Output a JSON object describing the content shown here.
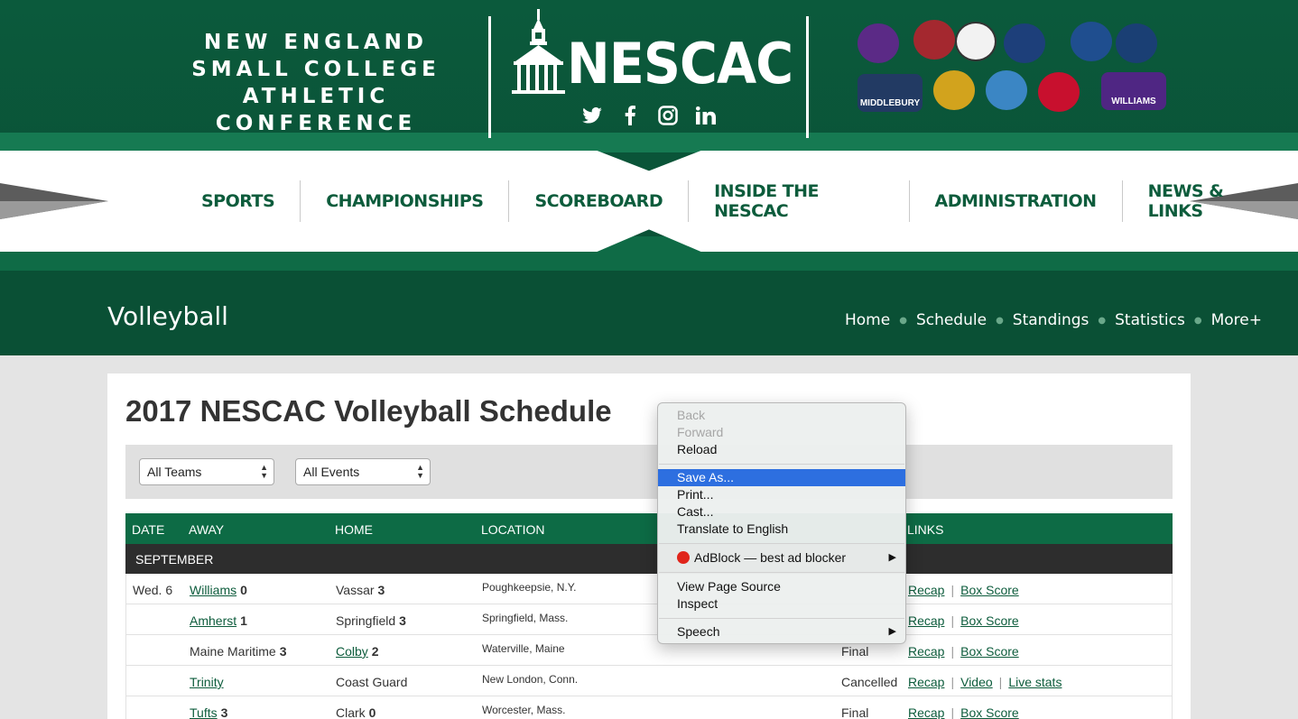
{
  "header": {
    "tagline": [
      "NEW ENGLAND",
      "SMALL COLLEGE",
      "ATHLETIC CONFERENCE"
    ],
    "logo_text": "NESCAC",
    "social": [
      "twitter-icon",
      "facebook-icon",
      "instagram-icon",
      "linkedin-icon"
    ],
    "teams": [
      {
        "icon": "amherst-mammoth-logo",
        "color": "#5b2a86"
      },
      {
        "icon": "bates-bobcat-logo",
        "color": "#a4282f"
      },
      {
        "icon": "bowdoin-polar-bear-logo",
        "color": "#f2f2f2"
      },
      {
        "icon": "colby-mule-logo",
        "color": "#1d3f7a"
      },
      {
        "icon": "conn-college-logo",
        "color": "#1f4e8f"
      },
      {
        "icon": "hamilton-logo",
        "color": "#1a3f74"
      },
      {
        "icon": "middlebury-panther-logo",
        "label": "MIDDLEBURY",
        "color": "#223a63"
      },
      {
        "icon": "trinity-bantam-logo",
        "color": "#d2a31d"
      },
      {
        "icon": "tufts-jumbo-logo",
        "color": "#3b86c4"
      },
      {
        "icon": "wesleyan-logo",
        "color": "#c8102e"
      },
      {
        "icon": "williams-ephs-logo",
        "label": "WILLIAMS",
        "color": "#4f2683"
      }
    ]
  },
  "main_nav": [
    "SPORTS",
    "CHAMPIONSHIPS",
    "SCOREBOARD",
    "INSIDE THE NESCAC",
    "ADMINISTRATION",
    "NEWS & LINKS"
  ],
  "sport": {
    "title": "Volleyball",
    "nav": [
      "Home",
      "Schedule",
      "Standings",
      "Statistics",
      "More+"
    ]
  },
  "page_title": "2017 NESCAC Volleyball Schedule",
  "filters": {
    "teams": "All Teams",
    "events": "All Events"
  },
  "table": {
    "headers": [
      "DATE",
      "AWAY",
      "HOME",
      "LOCATION",
      "LINKS"
    ],
    "month": "SEPTEMBER",
    "rows": [
      {
        "date": "Wed. 6",
        "away": "Williams",
        "away_link": true,
        "away_score": "0",
        "home": "Vassar",
        "home_link": false,
        "home_score": "3",
        "location": "Poughkeepsie, N.Y.",
        "result": "",
        "links": [
          "Recap",
          "Box Score"
        ]
      },
      {
        "date": "",
        "away": "Amherst",
        "away_link": true,
        "away_score": "1",
        "home": "Springfield",
        "home_link": false,
        "home_score": "3",
        "location": "Springfield, Mass.",
        "result": "",
        "links": [
          "Recap",
          "Box Score"
        ]
      },
      {
        "date": "",
        "away": "Maine Maritime",
        "away_link": false,
        "away_score": "3",
        "home": "Colby",
        "home_link": true,
        "home_score": "2",
        "location": "Waterville, Maine",
        "result": "Final",
        "links": [
          "Recap",
          "Box Score"
        ]
      },
      {
        "date": "",
        "away": "Trinity",
        "away_link": true,
        "away_score": "",
        "home": "Coast Guard",
        "home_link": false,
        "home_score": "",
        "location": "New London, Conn.",
        "result": "Cancelled",
        "links": [
          "Recap",
          "Video",
          "Live stats"
        ]
      },
      {
        "date": "",
        "away": "Tufts",
        "away_link": true,
        "away_score": "3",
        "home": "Clark",
        "home_link": false,
        "home_score": "0",
        "location": "Worcester, Mass.",
        "result": "Final",
        "links": [
          "Recap",
          "Box Score"
        ]
      }
    ]
  },
  "context_menu": {
    "back": "Back",
    "forward": "Forward",
    "reload": "Reload",
    "save_as": "Save As...",
    "print": "Print...",
    "cast": "Cast...",
    "translate": "Translate to English",
    "adblock": "AdBlock — best ad blocker",
    "view_source": "View Page Source",
    "inspect": "Inspect",
    "speech": "Speech"
  }
}
